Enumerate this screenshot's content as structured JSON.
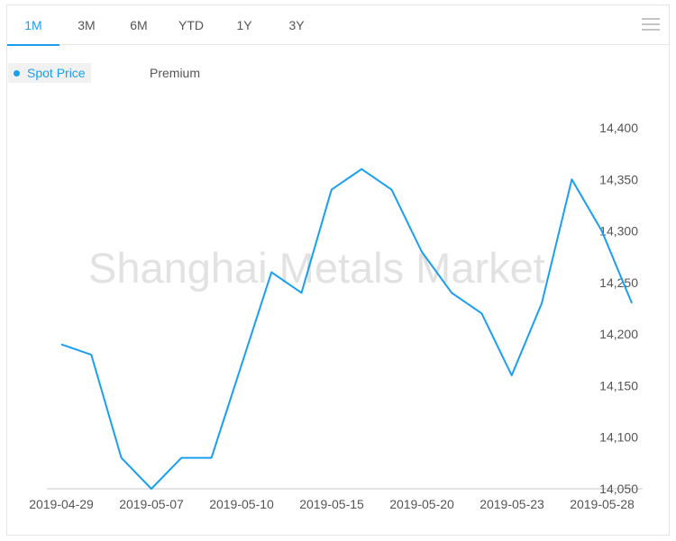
{
  "tabs": [
    {
      "label": "1M",
      "active": true
    },
    {
      "label": "3M",
      "active": false
    },
    {
      "label": "6M",
      "active": false
    },
    {
      "label": "YTD",
      "active": false
    },
    {
      "label": "1Y",
      "active": false
    },
    {
      "label": "3Y",
      "active": false
    }
  ],
  "menu_icon": "hamburger-menu-icon",
  "legend": {
    "active": "Spot Price",
    "inactive": "Premium"
  },
  "watermark": "Shanghai Metals Market",
  "colors": {
    "accent": "#1a9ff0",
    "line": "#1a9ff0"
  },
  "chart_data": {
    "type": "line",
    "series": [
      {
        "name": "Spot Price",
        "values": [
          14190,
          14180,
          14080,
          14050,
          14080,
          14080,
          14170,
          14260,
          14240,
          14340,
          14360,
          14340,
          14280,
          14240,
          14220,
          14160,
          14230,
          14350,
          14300,
          14230
        ]
      }
    ],
    "ylim": [
      14050,
      14400
    ],
    "yticks": [
      "14,050",
      "14,100",
      "14,150",
      "14,200",
      "14,250",
      "14,300",
      "14,350",
      "14,400"
    ],
    "xticks": [
      "2019-04-29",
      "2019-05-07",
      "2019-05-10",
      "2019-05-15",
      "2019-05-20",
      "2019-05-23",
      "2019-05-28"
    ],
    "grid": false
  }
}
